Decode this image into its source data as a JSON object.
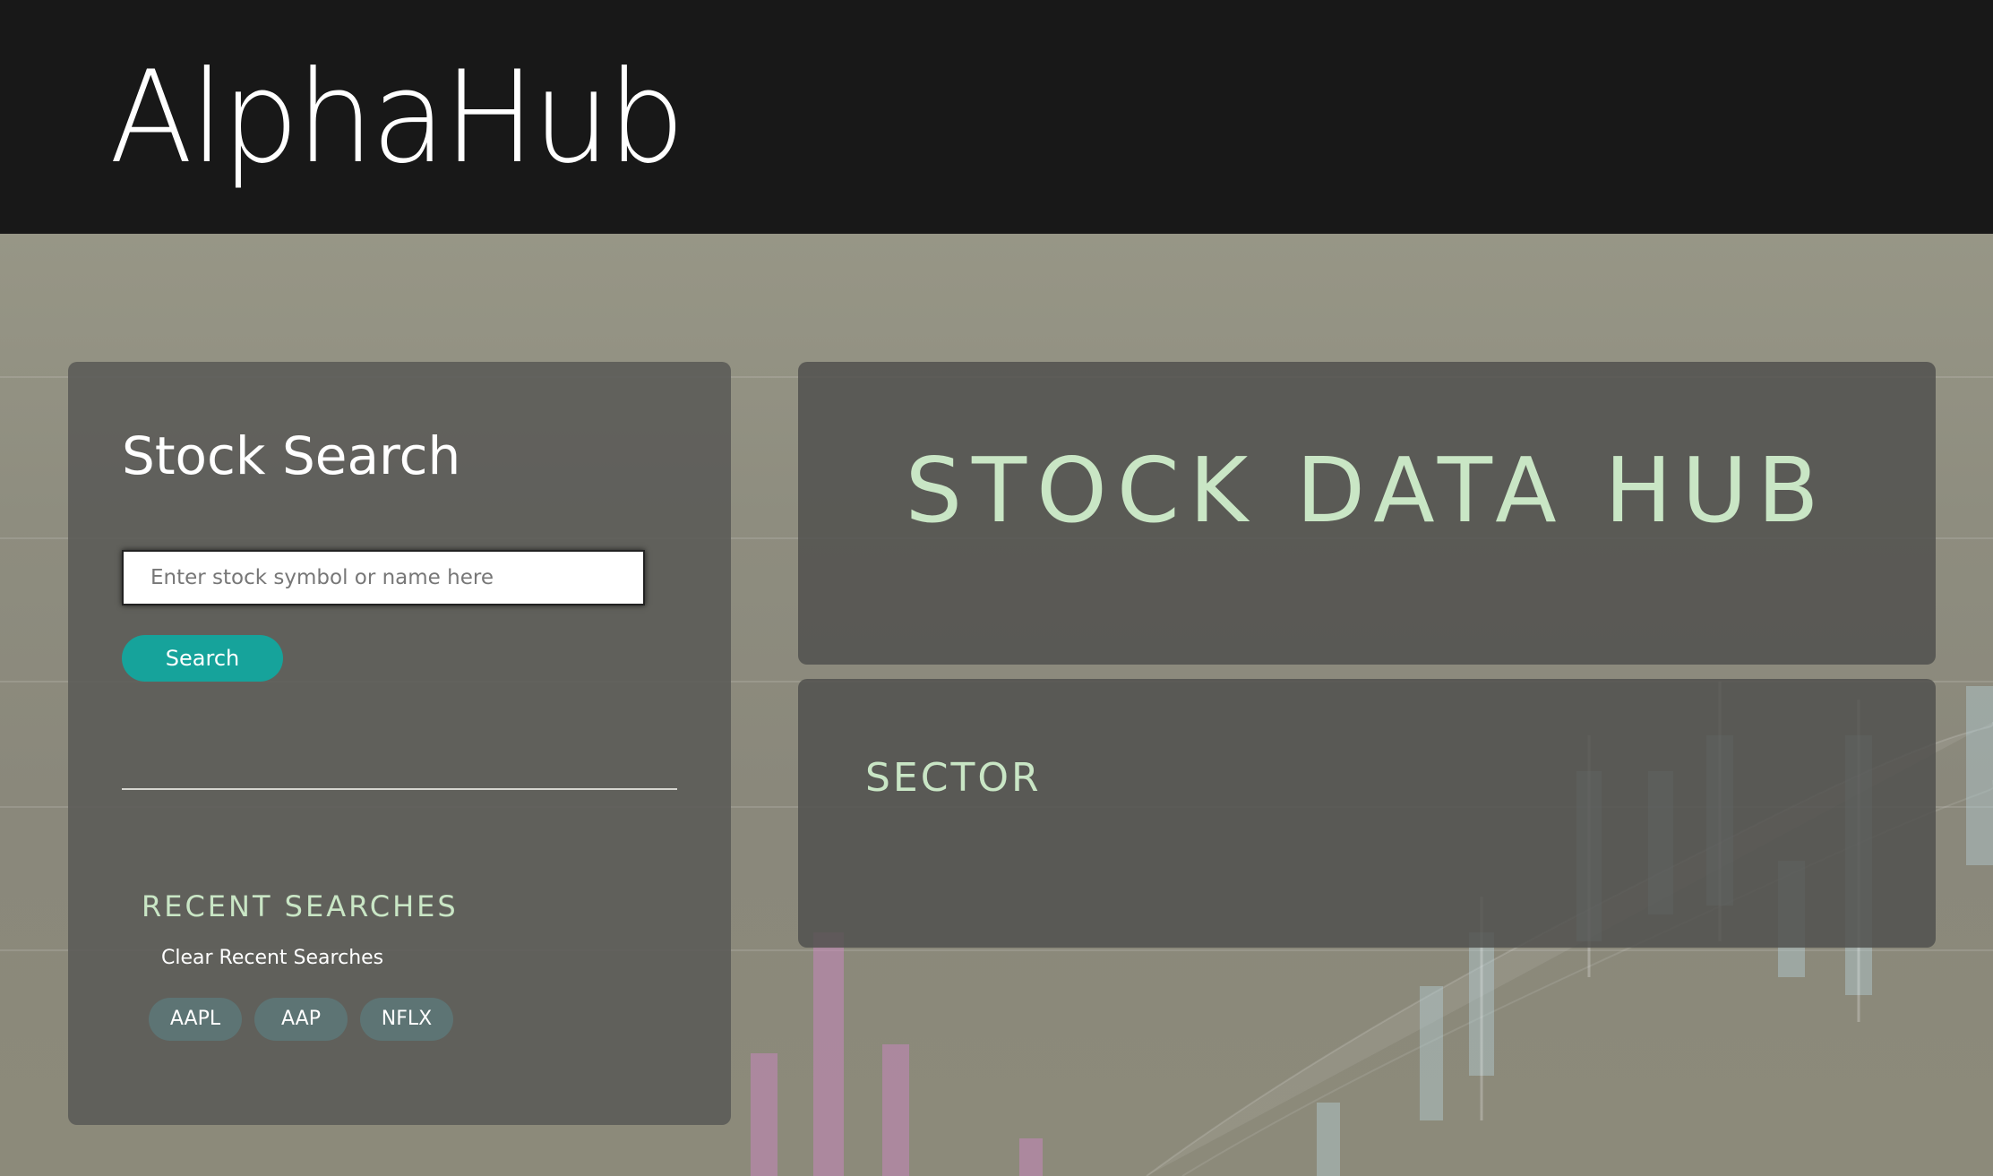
{
  "app": {
    "brand": "AlphaHub"
  },
  "search": {
    "title": "Stock Search",
    "placeholder": "Enter stock symbol or name here",
    "value": "",
    "button_label": "Search"
  },
  "recent": {
    "title": "RECENT SEARCHES",
    "clear_label": "Clear Recent Searches",
    "items": [
      "AAPL",
      "AAP",
      "NFLX"
    ]
  },
  "hub": {
    "title": "STOCK DATA HUB"
  },
  "sector": {
    "title": "SECTOR"
  },
  "colors": {
    "header_bg": "#181818",
    "accent_teal": "#16a39b",
    "heading_mint": "#c9e6c5",
    "chip_bg": "#5d7474"
  }
}
